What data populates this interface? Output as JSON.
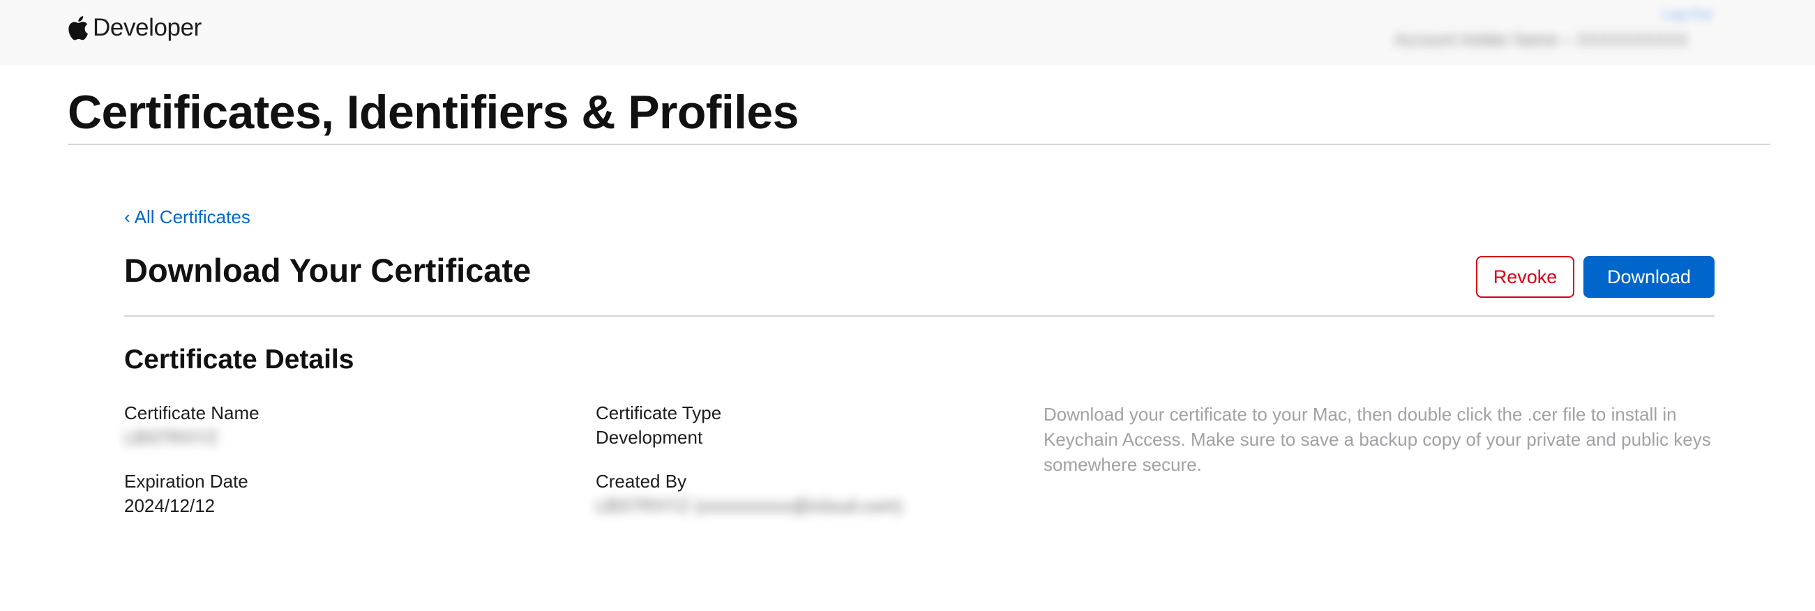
{
  "header": {
    "brand_text": "Developer",
    "brand_icon": "apple-logo-icon",
    "account_link_label": "Log Out",
    "account_name": "Account Holder Name – XXXXXXXXXX"
  },
  "page": {
    "title": "Certificates, Identifiers & Profiles"
  },
  "main": {
    "back_link_label": "All Certificates",
    "back_chevron": "‹",
    "section_title": "Download Your Certificate",
    "revoke_label": "Revoke",
    "download_label": "Download",
    "details_title": "Certificate Details",
    "fields": {
      "certificate_name": {
        "label": "Certificate Name",
        "value": "LBSTRXYZ"
      },
      "certificate_type": {
        "label": "Certificate Type",
        "value": "Development"
      },
      "expiration_date": {
        "label": "Expiration Date",
        "value": "2024/12/12"
      },
      "created_by": {
        "label": "Created By",
        "value": "LBSTRXYZ (xxxxxxxxxx@icloud.com)"
      }
    },
    "help_text": "Download your certificate to your Mac, then double click the .cer file to install in Keychain Access. Make sure to save a backup copy of your private and public keys somewhere secure."
  },
  "colors": {
    "accent_blue": "#0066cc",
    "revoke_red": "#d70015",
    "header_bg": "#f8f8f8",
    "divider": "#d6d6d6",
    "muted_text": "#a1a1a6"
  }
}
